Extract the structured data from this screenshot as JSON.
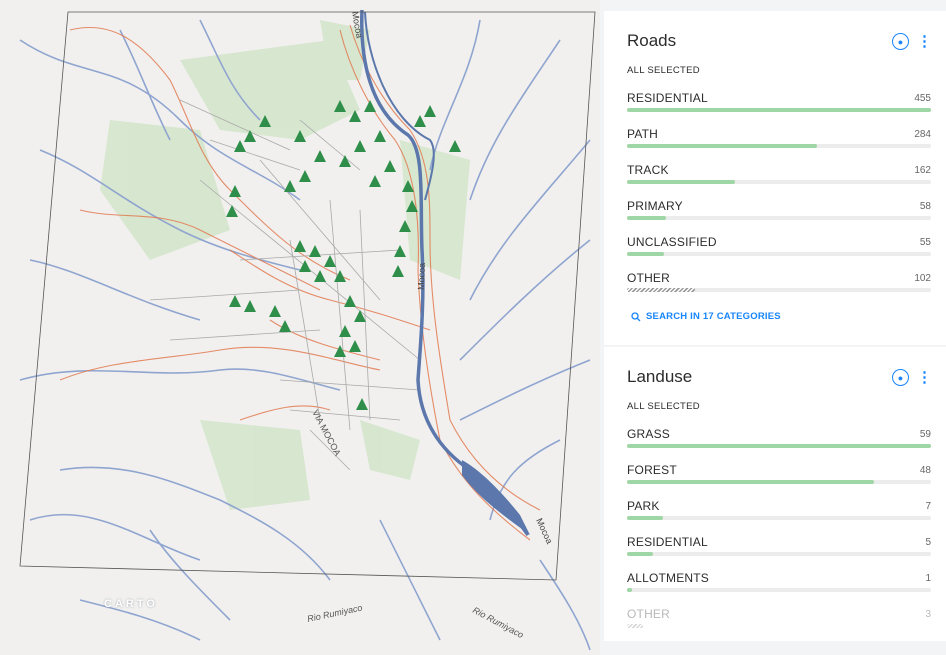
{
  "map": {
    "labels": {
      "river_mocoa_top": "Mocoa",
      "river_mocoa_mid": "Mocoa",
      "river_mocoa_bottom": "Mocoa",
      "road_via_mocoa": "VIA MOCOA",
      "river_rumiyaco_left": "Rio Rumiyaco",
      "river_rumiyaco_right": "Rio Rumiyaco"
    },
    "logo": "CARTO",
    "colors": {
      "water": "#5b77ab",
      "streams": "#8fa5cf",
      "contours": "#e27a50",
      "forest": "#2f8f4a",
      "landuse": "#d5e5cc",
      "roads": "#aaaaaa"
    }
  },
  "widgets": [
    {
      "title": "Roads",
      "subtitle": "ALL SELECTED",
      "categories": [
        {
          "name": "RESIDENTIAL",
          "value": "455",
          "ratio": 1.0
        },
        {
          "name": "PATH",
          "value": "284",
          "ratio": 0.624
        },
        {
          "name": "TRACK",
          "value": "162",
          "ratio": 0.356
        },
        {
          "name": "PRIMARY",
          "value": "58",
          "ratio": 0.127
        },
        {
          "name": "UNCLASSIFIED",
          "value": "55",
          "ratio": 0.121
        },
        {
          "name": "OTHER",
          "value": "102",
          "ratio": 0.224
        }
      ],
      "search_label": "SEARCH IN 17 CATEGORIES"
    },
    {
      "title": "Landuse",
      "subtitle": "ALL SELECTED",
      "categories": [
        {
          "name": "GRASS",
          "value": "59",
          "ratio": 1.0
        },
        {
          "name": "FOREST",
          "value": "48",
          "ratio": 0.814
        },
        {
          "name": "PARK",
          "value": "7",
          "ratio": 0.119
        },
        {
          "name": "RESIDENTIAL",
          "value": "5",
          "ratio": 0.085
        },
        {
          "name": "ALLOTMENTS",
          "value": "1",
          "ratio": 0.017
        },
        {
          "name": "OTHER",
          "value": "3",
          "ratio": 0.051
        }
      ]
    }
  ]
}
